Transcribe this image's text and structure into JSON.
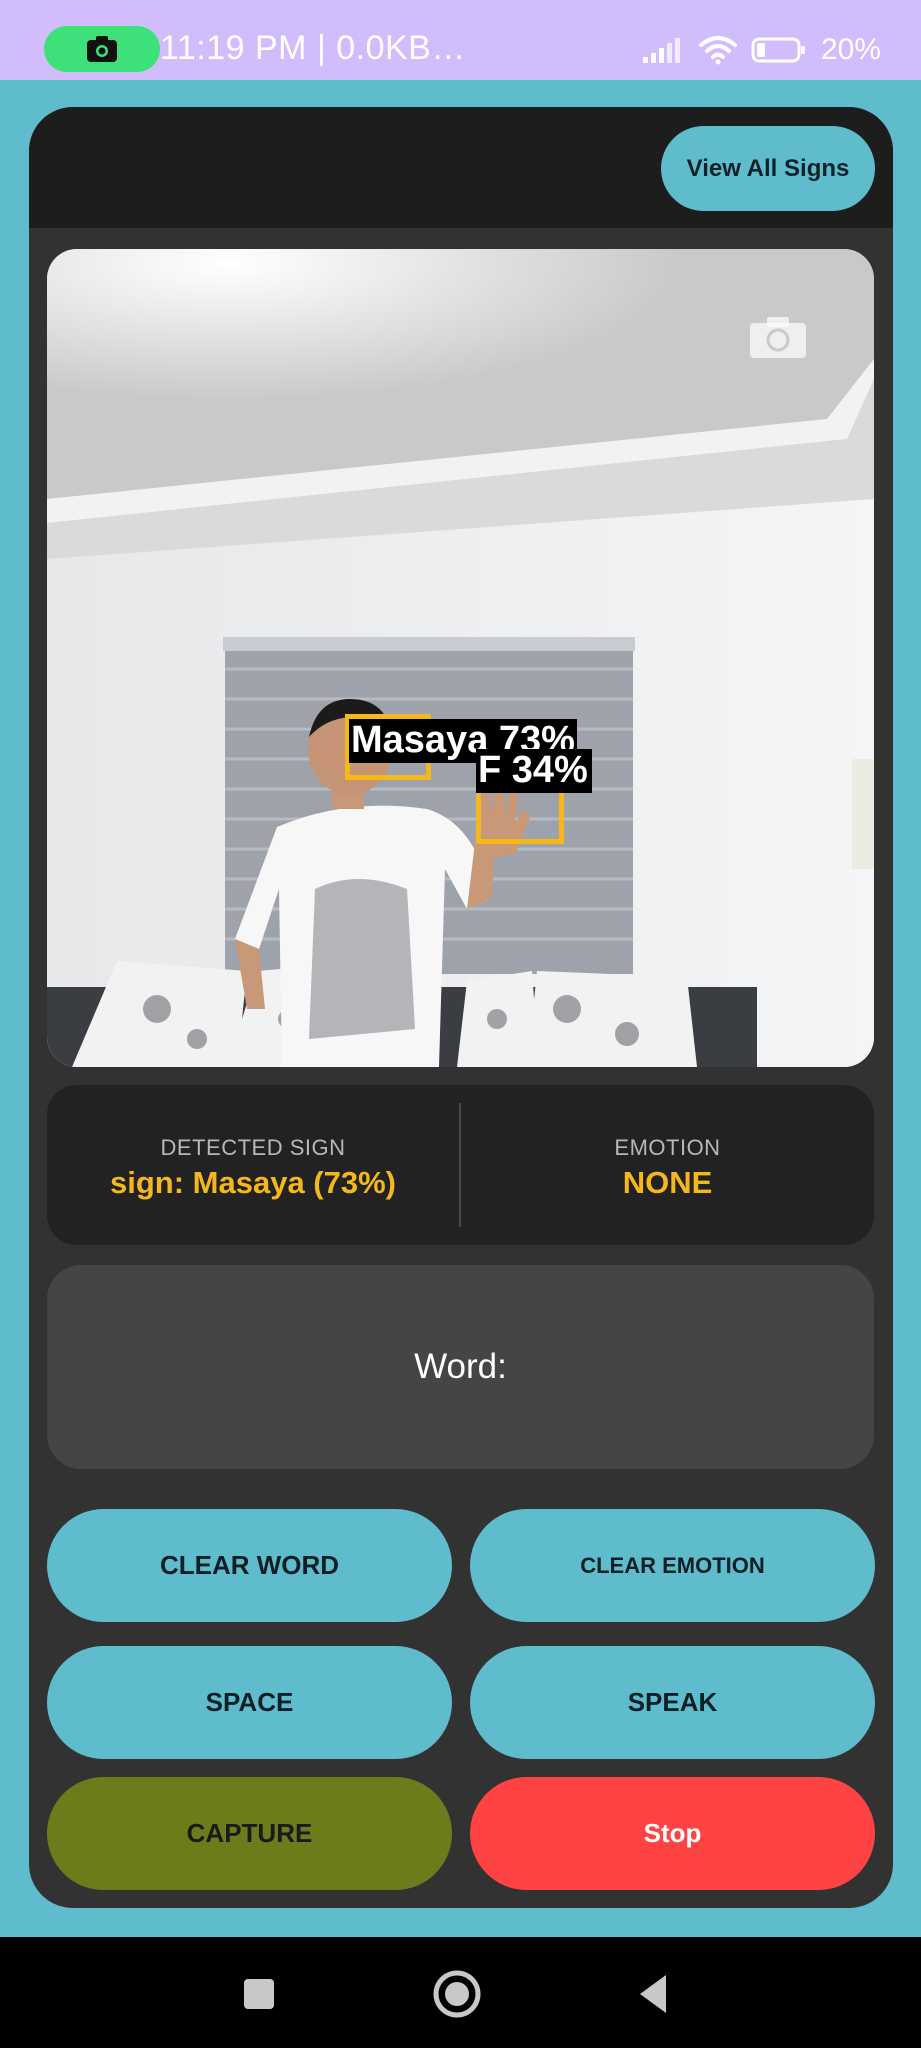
{
  "status_bar": {
    "time_and_speed": "11:19 PM | 0.0KB…",
    "battery": "20%",
    "icons": [
      "screen-record-icon",
      "signal-icon",
      "wifi-icon",
      "battery-icon"
    ]
  },
  "header": {
    "view_all_signs_label": "View All Signs"
  },
  "camera": {
    "switch_icon": "camera-switch-icon",
    "detections": [
      {
        "label": "Masaya 73%",
        "class": "Masaya",
        "confidence": 0.73
      },
      {
        "label": "F 34%",
        "class": "F",
        "confidence": 0.34
      }
    ]
  },
  "info": {
    "detected_sign_label": "DETECTED SIGN",
    "detected_sign_value": "sign: Masaya (73%)",
    "emotion_label": "EMOTION",
    "emotion_value": "NONE"
  },
  "word_panel": {
    "text": "Word:"
  },
  "buttons": {
    "clear_word": "CLEAR WORD",
    "clear_emotion": "CLEAR EMOTION",
    "space": "SPACE",
    "speak": "SPEAK",
    "capture": "CAPTURE",
    "stop": "Stop"
  },
  "colors": {
    "accent_teal": "#5fbccd",
    "highlight_yellow": "#f4b81c",
    "capture_olive": "#6b7d1a",
    "stop_red": "#ff4343",
    "status_bar_lavender": "#d1bdfb"
  },
  "nav_bar": {
    "icons": [
      "recents-icon",
      "home-icon",
      "back-icon"
    ]
  }
}
